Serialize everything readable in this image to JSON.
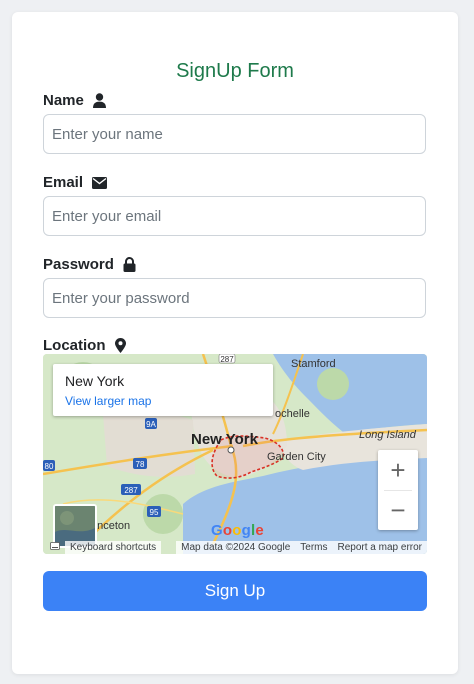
{
  "form": {
    "title": "SignUp Form",
    "name_label": "Name",
    "name_placeholder": "Enter your name",
    "email_label": "Email",
    "email_placeholder": "Enter your email",
    "password_label": "Password",
    "password_placeholder": "Enter your password",
    "location_label": "Location",
    "submit_label": "Sign Up"
  },
  "map": {
    "info_title": "New York",
    "info_link": "View larger map",
    "zoom_in": "+",
    "zoom_out": "−",
    "labels": {
      "stamford": "Stamford",
      "rochelle": "ochelle",
      "new_york": "New York",
      "long_island": "Long Island",
      "garden_city": "Garden City",
      "princeton": "rinceton",
      "road_287_top": "287",
      "road_287_left": "287",
      "road_78": "78",
      "road_95": "95",
      "road_9a": "9A",
      "road_80": "80"
    },
    "attribution": {
      "keyboard": "Keyboard shortcuts",
      "data": "Map data ©2024 Google",
      "terms": "Terms",
      "report": "Report a map error"
    }
  },
  "icons": {
    "name": "user-icon",
    "email": "envelope-icon",
    "password": "lock-icon",
    "location": "map-pin-icon"
  },
  "colors": {
    "title": "#1e7a4b",
    "button": "#3b82f6",
    "link": "#1a73e8"
  }
}
